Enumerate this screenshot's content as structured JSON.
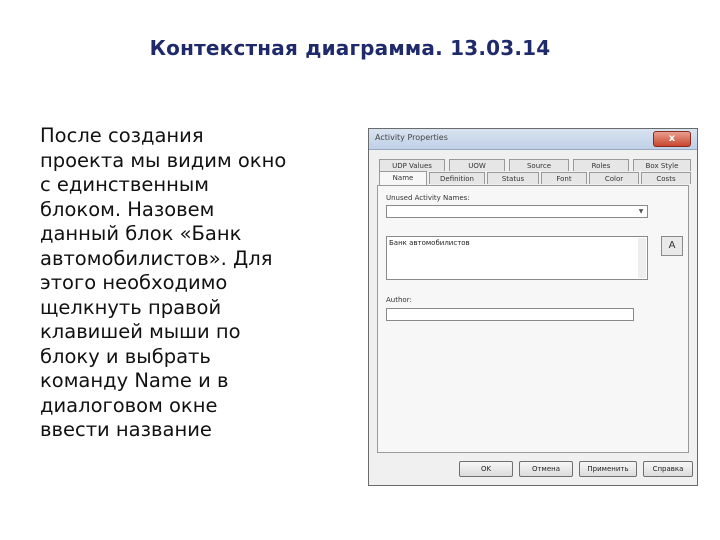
{
  "slide": {
    "title": "Контекстная диаграмма. 13.03.14",
    "body_lines": [
      "После создания",
      "проекта мы видим окно",
      "с единственным",
      "блоком. Назовем",
      "данный блок «Банк",
      "автомобилистов». Для",
      "этого необходимо",
      "щелкнуть правой",
      "клавишей мыши по",
      "блоку и выбрать",
      "команду Name и в",
      "диалоговом окне",
      "ввести название"
    ]
  },
  "dialog": {
    "title": "Activity Properties",
    "close_label": "x",
    "tabs_row1": [
      "UDP Values",
      "UOW",
      "Source",
      "Roles",
      "Box Style"
    ],
    "tabs_row2": [
      "Name",
      "Definition",
      "Status",
      "Font",
      "Color",
      "Costs"
    ],
    "active_tab": "Name",
    "unused_names_label": "Unused Activity Names:",
    "unused_names_value": "",
    "activity_name_value": "Банк автомобилистов",
    "spell_icon": "spell-check-icon",
    "spell_glyph": "A",
    "author_label": "Author:",
    "author_value": "",
    "buttons": {
      "ok": "OK",
      "cancel": "Отмена",
      "apply": "Применить",
      "help": "Справка"
    }
  }
}
